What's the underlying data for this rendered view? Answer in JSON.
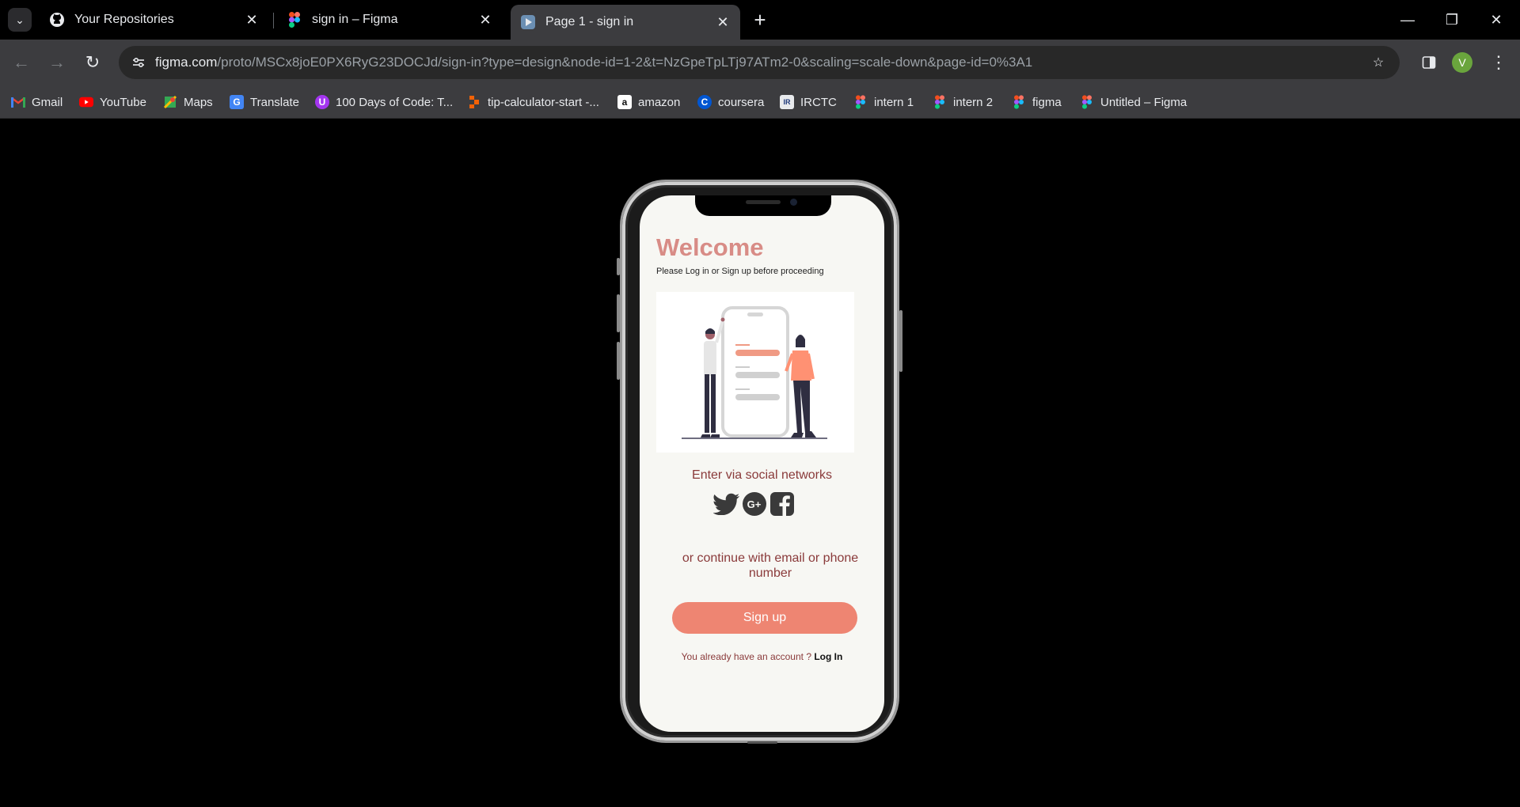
{
  "tabs": [
    {
      "title": "Your Repositories",
      "icon": "github-icon",
      "active": false
    },
    {
      "title": "sign in – Figma",
      "icon": "figma-icon",
      "active": false
    },
    {
      "title": "Page 1 - sign in",
      "icon": "figma-proto-icon",
      "active": true
    }
  ],
  "address_bar": {
    "host": "figma.com",
    "path": "/proto/MSCx8joE0PX6RyG23DOCJd/sign-in?type=design&node-id=1-2&t=NzGpeTpLTj97ATm2-0&scaling=scale-down&page-id=0%3A1"
  },
  "profile": {
    "initial": "V",
    "color": "#6aa53d"
  },
  "bookmarks": [
    {
      "label": "Gmail",
      "icon": "gmail-icon"
    },
    {
      "label": "YouTube",
      "icon": "youtube-icon"
    },
    {
      "label": "Maps",
      "icon": "maps-icon"
    },
    {
      "label": "Translate",
      "icon": "translate-icon"
    },
    {
      "label": "100 Days of Code: T...",
      "icon": "udemy-icon"
    },
    {
      "label": "tip-calculator-start -...",
      "icon": "replit-icon"
    },
    {
      "label": "amazon",
      "icon": "amazon-icon"
    },
    {
      "label": "coursera",
      "icon": "coursera-icon"
    },
    {
      "label": "IRCTC",
      "icon": "irctc-icon"
    },
    {
      "label": "intern 1",
      "icon": "figma-icon"
    },
    {
      "label": "intern 2",
      "icon": "figma-icon"
    },
    {
      "label": "figma",
      "icon": "figma-icon"
    },
    {
      "label": "Untitled – Figma",
      "icon": "figma-icon"
    }
  ],
  "app": {
    "title": "Welcome",
    "subtitle": "Please Log in or Sign up before proceeding",
    "social_label": "Enter via social networks",
    "social_icons": [
      "twitter-icon",
      "google-plus-icon",
      "facebook-icon"
    ],
    "continue_label": "or continue with email or phone number",
    "signup_label": "Sign up",
    "login_prompt": "You already have an  account ?",
    "login_link": "Log In",
    "accent": "#ee8572",
    "title_color": "#d88c86",
    "text_color": "#8a3a3a"
  }
}
